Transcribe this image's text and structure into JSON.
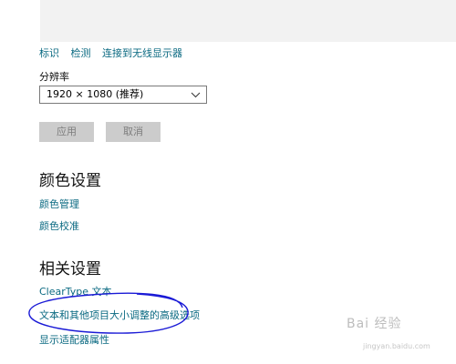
{
  "top_links": [
    "标识",
    "检测",
    "连接到无线显示器"
  ],
  "resolution": {
    "label": "分辨率",
    "selected": "1920 × 1080 (推荐)",
    "chevron_icon": "chevron-down-icon"
  },
  "buttons": {
    "apply": "应用",
    "cancel": "取消"
  },
  "color_settings": {
    "title": "颜色设置",
    "links": [
      "颜色管理",
      "颜色校准"
    ]
  },
  "related_settings": {
    "title": "相关设置",
    "links": [
      "ClearType 文本",
      "文本和其他项目大小调整的高级选项",
      "显示适配器属性"
    ]
  },
  "annotation_color": "#1a1ad6",
  "watermark": {
    "text": "Bai 经验",
    "sub": "jingyan.baidu.com"
  }
}
